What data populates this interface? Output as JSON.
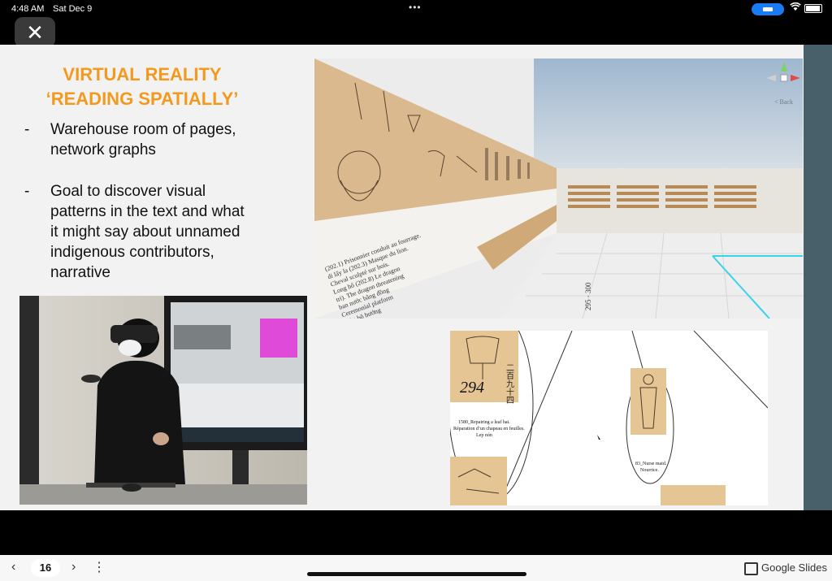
{
  "status_bar": {
    "time": "4:48 AM",
    "date": "Sat Dec 9",
    "dots": "•••"
  },
  "close_button": {
    "glyph": "✕"
  },
  "slide": {
    "title_line1": "VIRTUAL REALITY",
    "title_line2": "‘READING SPATIALLY’",
    "title_color": "#f39a1e",
    "bullets": [
      {
        "dash": "-",
        "text": "Warehouse room of pages, network graphs"
      },
      {
        "dash": "-",
        "text": "Goal to discover visual patterns in the text and what it might say about unnamed indigenous contributors, narrative"
      }
    ],
    "vr_wall_caption": [
      "(202.1) Prisonnier conduit au fourrage.",
      "di lấy la (202.3) Masque du lion.",
      "Cheval sculpté sur bois.",
      "Long hổ (202.8) Le dragon",
      "tri). The dragon threatening",
      "ban nước bằng đồng",
      "Ceremonial platform",
      "Mùa bô bướng"
    ],
    "vr_column_label": "295 · 300",
    "vr_back": "< Back",
    "graph": {
      "char_numbers": "二百九十四",
      "number": "294",
      "caption1_line1": "1580_Repairing a leaf hat.",
      "caption1_line2": "Réparation d’un chapeau en feuilles.",
      "caption1_line3": "Lep nón",
      "caption2_line1": "83_Nurse maid.",
      "caption2_line2": "Nourrice."
    }
  },
  "bottom_bar": {
    "prev_glyph": "‹",
    "page_number": "16",
    "next_glyph": "›",
    "more_glyph": "⋮",
    "app_label": "Google Slides"
  }
}
